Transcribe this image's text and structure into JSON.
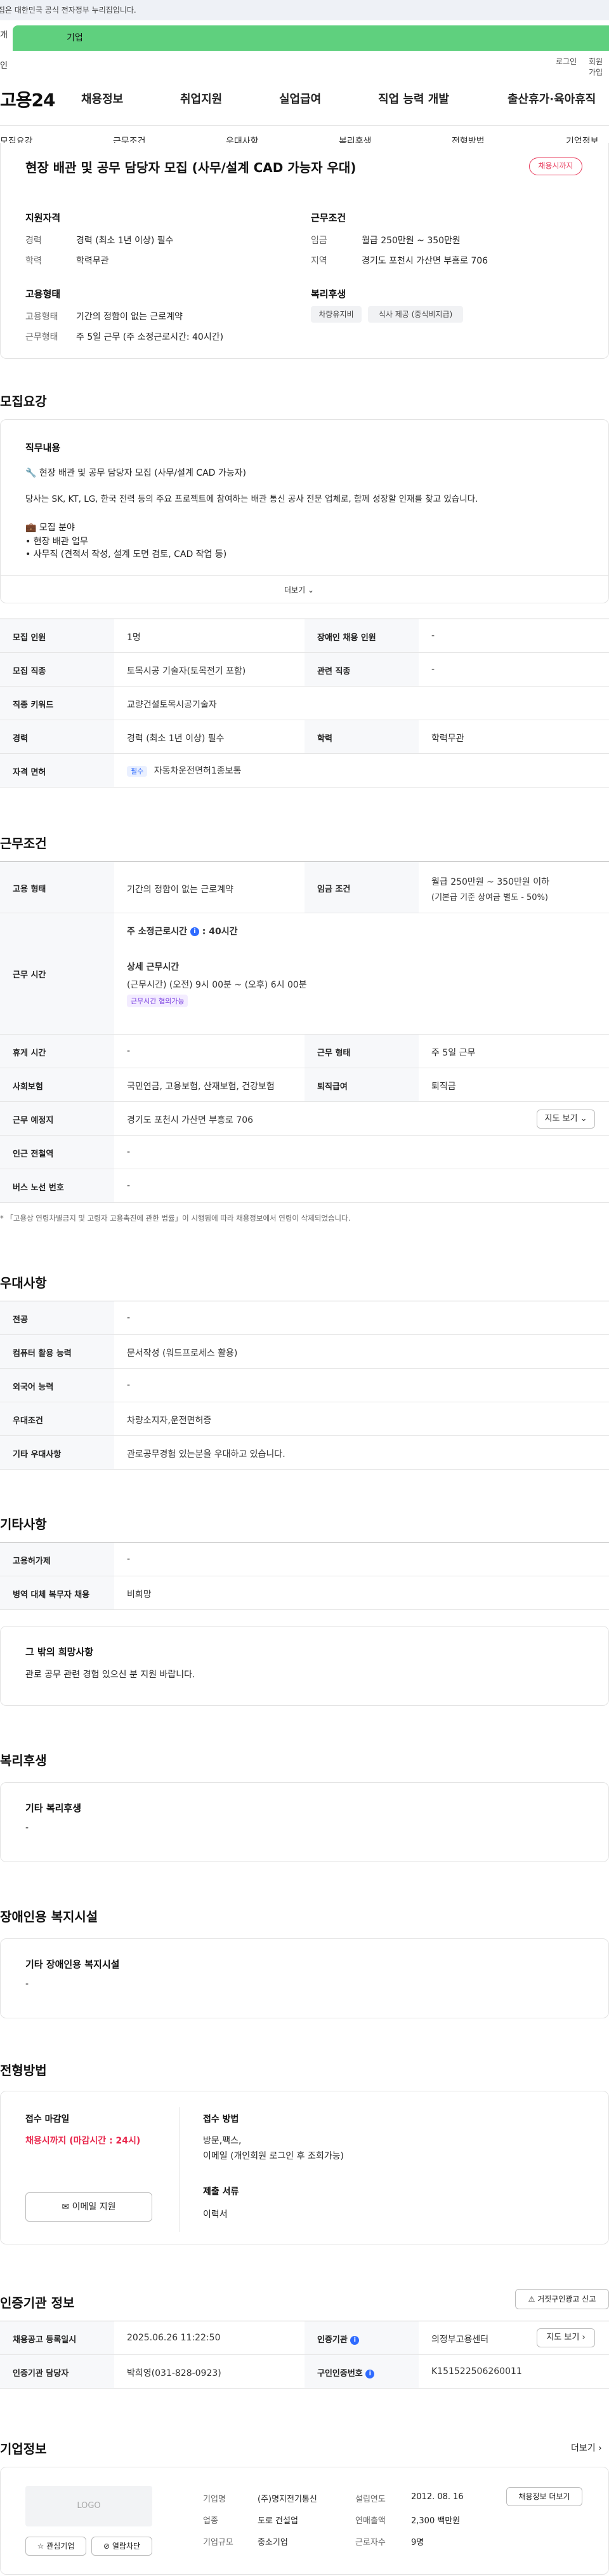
{
  "gov_banner": "이 누리집은 대한민국 공식 전자정부 누리집입니다.",
  "top_tabs": {
    "personal": "개인",
    "corporate": "기업"
  },
  "util": {
    "login": "로그인",
    "signup": "회원가입"
  },
  "logo": "고용24",
  "gnb": [
    "채용정보",
    "취업지원",
    "실업급여",
    "직업 능력 개발",
    "출산휴가·육아휴직"
  ],
  "subnav": [
    "모집요강",
    "근무조건",
    "우대사항",
    "복리후생",
    "전형방법",
    "기업정보"
  ],
  "summary": {
    "title": "현장 배관 및 공무 담당자 모집 (사무/설계 CAD 가능자 우대)",
    "badge": "채용시까지",
    "qual_title": "지원자격",
    "qual": [
      {
        "k": "경력",
        "v": "경력 (최소 1년 이상) 필수"
      },
      {
        "k": "학력",
        "v": "학력무관"
      }
    ],
    "cond_title": "근무조건",
    "cond": [
      {
        "k": "임금",
        "v": "월급 250만원 ~ 350만원"
      },
      {
        "k": "지역",
        "v": "경기도 포천시 가산면 부흥로 706"
      }
    ],
    "emp_title": "고용형태",
    "emp": [
      {
        "k": "고용형태",
        "v": "기간의 정함이 없는 근로계약"
      },
      {
        "k": "근무형태",
        "v": "주 5일 근무 (주 소정근로시간: 40시간)"
      }
    ],
    "welfare_title": "복리후생",
    "welfare_chips": [
      "차량유지비",
      "식사 제공 (중식비지급)"
    ]
  },
  "recruit": {
    "section_title": "모집요강",
    "duty_title": "직무내용",
    "duty_lines": [
      "🔧 현장 배관 및 공무 담당자 모집 (사무/설계 CAD 가능자)",
      "당사는 SK, KT, LG, 한국 전력 등의 주요 프로젝트에 참여하는 배관 통신 공사 전문 업체로, 함께 성장할 인재를 찾고 있습니다.",
      "💼 모집 분야",
      "• 현장 배관 업무",
      "• 사무직 (견적서 작성, 설계 도면 검토, CAD 작업 등)"
    ],
    "more": "더보기",
    "rows": [
      [
        {
          "k": "모집 인원",
          "v": "1명"
        },
        {
          "k": "장애인 채용 인원",
          "v": "-"
        }
      ],
      [
        {
          "k": "모집 직종",
          "v": "토목시공 기술자(토목전기 포함)"
        },
        {
          "k": "관련 직종",
          "v": "-"
        }
      ],
      [
        {
          "k": "직종 키워드",
          "v": "교량건설토목시공기술자"
        }
      ],
      [
        {
          "k": "경력",
          "v": "경력 (최소 1년 이상) 필수"
        },
        {
          "k": "학력",
          "v": "학력무관"
        }
      ],
      [
        {
          "k": "자격 면허",
          "v": "자동차운전면허1종보통",
          "tag": "필수"
        }
      ]
    ]
  },
  "work": {
    "section_title": "근무조건",
    "emp_type_k": "고용 형태",
    "emp_type_v": "기간의 정함이 없는 근로계약",
    "wage_k": "임금 조건",
    "wage_v": "월급 250만원 ~ 350만원 이하",
    "wage_note": "(기본급 기준 상여금 별도 - 50%)",
    "hours_k": "근무 시간",
    "hours_weekly": "주 소정근로시간",
    "hours_weekly_v": "40시간",
    "hours_detail_title": "상세 근무시간",
    "hours_detail": "(근무시간) (오전) 9시 00분 ~ (오후) 6시 00분",
    "hours_tag": "근무시간 협의가능",
    "rest_k": "휴게 시간",
    "rest_v": "-",
    "shape_k": "근무 형태",
    "shape_v": "주 5일 근무",
    "ins_k": "사회보험",
    "ins_v": "국민연금, 고용보험, 산재보험, 건강보험",
    "sev_k": "퇴직급여",
    "sev_v": "퇴직금",
    "place_k": "근무 예정지",
    "place_v": "경기도 포천시 가산면 부흥로 706",
    "map_btn": "지도 보기",
    "station_k": "인근 전철역",
    "station_v": "-",
    "bus_k": "버스 노선 번호",
    "bus_v": "-",
    "notice": "* 「고용상 연령차별금지 및 고령자 고용촉진에 관한 법률」이 시행됨에 따라 채용정보에서 연령이 삭제되었습니다."
  },
  "pref": {
    "section_title": "우대사항",
    "rows": [
      {
        "k": "전공",
        "v": "-"
      },
      {
        "k": "컴퓨터 활용 능력",
        "v": "문서작성 (워드프로세스 활용)"
      },
      {
        "k": "외국어 능력",
        "v": "-"
      },
      {
        "k": "우대조건",
        "v": "차량소지자,운전면허증"
      },
      {
        "k": "기타 우대사항",
        "v": "관로공무경험 있는분을 우대하고 있습니다."
      }
    ]
  },
  "etc": {
    "section_title": "기타사항",
    "rows": [
      {
        "k": "고용허가제",
        "v": "-"
      },
      {
        "k": "병역 대체 복무자 채용",
        "v": "비희망"
      }
    ],
    "wish_title": "그 밖의 희망사항",
    "wish_text": "관로 공무 관련 경험 있으신 분 지원 바랍니다."
  },
  "welfare": {
    "section_title": "복리후생",
    "box_title": "기타 복리후생",
    "box_v": "-"
  },
  "disabled": {
    "section_title": "장애인용 복지시설",
    "box_title": "기타 장애인용 복지시설",
    "box_v": "-"
  },
  "process": {
    "section_title": "전형방법",
    "deadline_title": "접수 마감일",
    "deadline_v": "채용시까지 (마감시간 : 24시)",
    "email_btn": "이메일 지원",
    "method_title": "접수 방법",
    "method_v1": "방문,팩스,",
    "method_v2": "이메일 (개인회원 로그인 후 조회가능)",
    "docs_title": "제출 서류",
    "docs_v": "이력서"
  },
  "agency": {
    "section_title": "인증기관 정보",
    "btn": "거짓구인광고 신고",
    "reg_k": "채용공고 등록일시",
    "reg_v": "2025.06.26 11:22:50",
    "org_k": "인증기관",
    "org_v": "의정부고용센터",
    "map_btn": "지도 보기",
    "mgr_k": "인증기관 담당자",
    "mgr_v": "박희영(031-828-0923)",
    "no_k": "구인인증번호",
    "no_v": "K151522506260011"
  },
  "company": {
    "section_title": "기업정보",
    "more": "더보기",
    "logo_placeholder": "LOGO",
    "fav_btn": "관심기업",
    "block_btn": "열람차단",
    "rows": [
      [
        {
          "k": "기업명",
          "v": "(주)명지전기통신"
        },
        {
          "k": "설립연도",
          "v": "2012. 08. 16"
        }
      ],
      [
        {
          "k": "업종",
          "v": "도로 건설업"
        },
        {
          "k": "연매출액",
          "v": "2,300 백만원"
        }
      ],
      [
        {
          "k": "기업규모",
          "v": "중소기업"
        },
        {
          "k": "근로자수",
          "v": "9명"
        }
      ]
    ],
    "jobs_btn": "채용정보 더보기"
  }
}
